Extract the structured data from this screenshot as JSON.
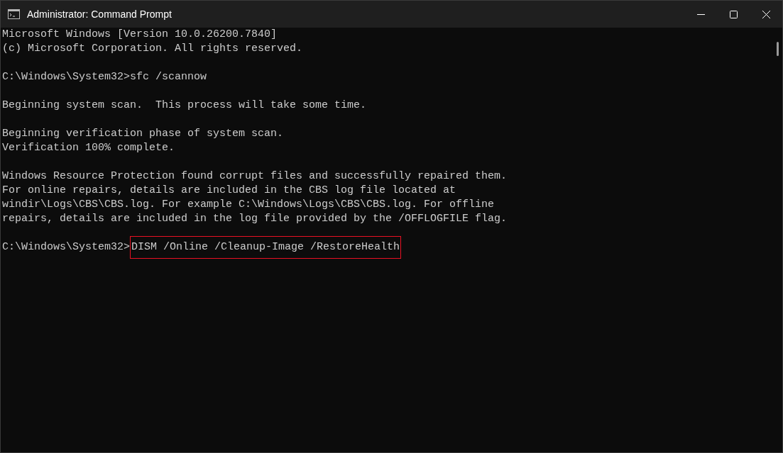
{
  "window": {
    "title": "Administrator: Command Prompt"
  },
  "console": [
    {
      "kind": "output",
      "lines": [
        "Microsoft Windows [Version 10.0.26200.7840]",
        "(c) Microsoft Corporation. All rights reserved."
      ]
    },
    {
      "kind": "prompt",
      "prompt": "C:\\Windows\\System32>",
      "command": "sfc /scannow",
      "highlighted": false
    },
    {
      "kind": "output",
      "lines": [
        "Beginning system scan.  This process will take some time."
      ]
    },
    {
      "kind": "output",
      "lines": [
        "Beginning verification phase of system scan.",
        "Verification 100% complete."
      ]
    },
    {
      "kind": "output",
      "lines": [
        "Windows Resource Protection found corrupt files and successfully repaired them.",
        "For online repairs, details are included in the CBS log file located at",
        "windir\\Logs\\CBS\\CBS.log. For example C:\\Windows\\Logs\\CBS\\CBS.log. For offline",
        "repairs, details are included in the log file provided by the /OFFLOGFILE flag."
      ]
    },
    {
      "kind": "prompt",
      "prompt": "C:\\Windows\\System32>",
      "command": "DISM /Online /Cleanup-Image /RestoreHealth",
      "highlighted": true
    }
  ]
}
